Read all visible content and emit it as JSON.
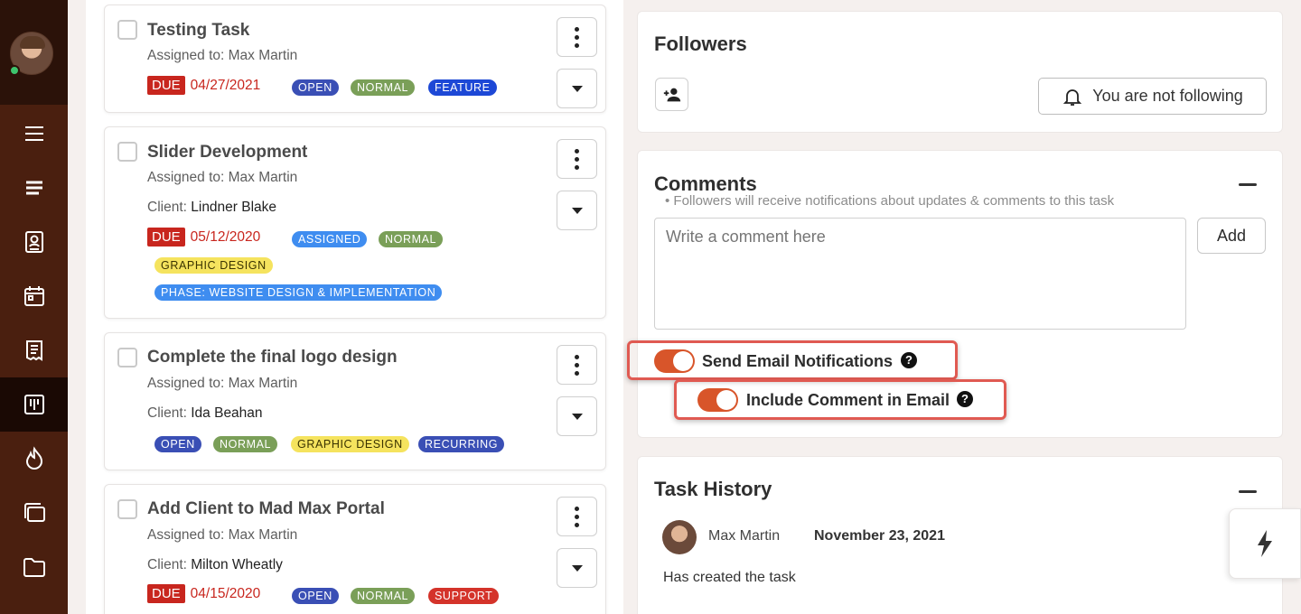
{
  "sidebar": {
    "icons": [
      "menu-icon",
      "list-icon",
      "contacts-icon",
      "calendar-icon",
      "invoice-icon",
      "tasks-icon",
      "leads-icon",
      "projects-icon",
      "folder-icon"
    ]
  },
  "tasks": [
    {
      "title": "Testing Task",
      "assigned_label": "Assigned to: Max Martin",
      "due_label": "DUE",
      "due_date": "04/27/2021",
      "tags": [
        "OPEN",
        "NORMAL",
        "FEATURE"
      ]
    },
    {
      "title": "Slider Development",
      "assigned_label": "Assigned to: Max Martin",
      "client_label": "Client:",
      "client_name": "Lindner Blake",
      "due_label": "DUE",
      "due_date": "05/12/2020",
      "tags": [
        "ASSIGNED",
        "NORMAL",
        "GRAPHIC DESIGN",
        "PHASE: WEBSITE DESIGN & IMPLEMENTATION"
      ]
    },
    {
      "title": "Complete the final logo design",
      "assigned_label": "Assigned to: Max Martin",
      "client_label": "Client:",
      "client_name": "Ida Beahan",
      "tags": [
        "OPEN",
        "NORMAL",
        "GRAPHIC DESIGN",
        "RECURRING"
      ]
    },
    {
      "title": "Add Client to Mad Max Portal",
      "assigned_label": "Assigned to: Max Martin",
      "client_label": "Client:",
      "client_name": "Milton Wheatly",
      "due_label": "DUE",
      "due_date": "04/15/2020",
      "tags": [
        "OPEN",
        "NORMAL",
        "SUPPORT"
      ]
    }
  ],
  "followers": {
    "title": "Followers",
    "follow_label": "You are not following"
  },
  "comments": {
    "title": "Comments",
    "hint": "• Followers will receive notifications about updates & comments to this task",
    "placeholder": "Write a comment here",
    "add_label": "Add",
    "send_email_label": "Send Email Notifications",
    "send_email_on": true,
    "include_comment_label": "Include Comment in Email",
    "include_comment_on": true
  },
  "history": {
    "title": "Task History",
    "entries": [
      {
        "user": "Max Martin",
        "date": "November 23, 2021",
        "text": "Has created the task"
      }
    ]
  },
  "colors": {
    "sidebar_bg": "#4a1f0f",
    "accent_orange": "#d8552a",
    "due_red": "#c8261e",
    "highlight": "#e05a52"
  }
}
